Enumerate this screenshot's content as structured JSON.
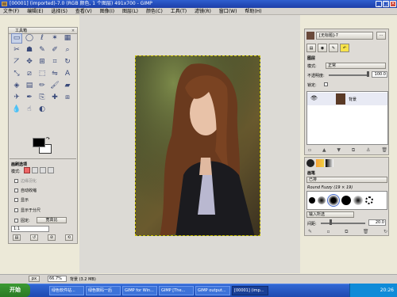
{
  "window": {
    "title": "[00001] (imported)-7.0 (RGB 颜色, 1 个图层) 491x700 - GIMP",
    "min": "_",
    "max": "□",
    "close": "×"
  },
  "menu": [
    "文件(F)",
    "编辑(E)",
    "选择(S)",
    "查看(V)",
    "图像(I)",
    "图层(L)",
    "颜色(C)",
    "工具(T)",
    "滤镜(R)",
    "窗口(W)",
    "帮助(H)"
  ],
  "toolbox": {
    "title": "工具箱",
    "tools": [
      {
        "name": "rect-select-icon",
        "glyph": "▭"
      },
      {
        "name": "ellipse-select-icon",
        "glyph": "◯"
      },
      {
        "name": "free-select-icon",
        "glyph": "ℓ"
      },
      {
        "name": "fuzzy-select-icon",
        "glyph": "✶"
      },
      {
        "name": "color-select-icon",
        "glyph": "▦"
      },
      {
        "name": "scissors-icon",
        "glyph": "✂"
      },
      {
        "name": "foreground-select-icon",
        "glyph": "☗"
      },
      {
        "name": "paths-icon",
        "glyph": "✎"
      },
      {
        "name": "color-picker-icon",
        "glyph": "✐"
      },
      {
        "name": "zoom-icon",
        "glyph": "⌕"
      },
      {
        "name": "measure-icon",
        "glyph": "⦢"
      },
      {
        "name": "move-icon",
        "glyph": "✥"
      },
      {
        "name": "align-icon",
        "glyph": "⊞"
      },
      {
        "name": "crop-icon",
        "glyph": "⌗"
      },
      {
        "name": "rotate-icon",
        "glyph": "↻"
      },
      {
        "name": "scale-icon",
        "glyph": "⤡"
      },
      {
        "name": "shear-icon",
        "glyph": "⧄"
      },
      {
        "name": "perspective-icon",
        "glyph": "⬚"
      },
      {
        "name": "flip-icon",
        "glyph": "⇋"
      },
      {
        "name": "text-icon",
        "glyph": "A"
      },
      {
        "name": "bucket-fill-icon",
        "glyph": "◈"
      },
      {
        "name": "blend-icon",
        "glyph": "▤"
      },
      {
        "name": "pencil-icon",
        "glyph": "✏"
      },
      {
        "name": "paintbrush-icon",
        "glyph": "🖌"
      },
      {
        "name": "eraser-icon",
        "glyph": "▰"
      },
      {
        "name": "airbrush-icon",
        "glyph": "✈"
      },
      {
        "name": "ink-icon",
        "glyph": "✒"
      },
      {
        "name": "clone-icon",
        "glyph": "⎘"
      },
      {
        "name": "heal-icon",
        "glyph": "✚"
      },
      {
        "name": "perspective-clone-icon",
        "glyph": "⧈"
      },
      {
        "name": "blur-icon",
        "glyph": "💧"
      },
      {
        "name": "smudge-icon",
        "glyph": "☝"
      },
      {
        "name": "dodge-burn-icon",
        "glyph": "◐"
      }
    ],
    "fg_color": "#000000",
    "bg_color": "#ffffff"
  },
  "tool_options": {
    "title": "画刷选项",
    "mode_label": "模式:",
    "options": [
      "边缘羽化",
      "自动收缩",
      "显示",
      "显示于分尺",
      "固定:"
    ],
    "fixed_value": "宽高比",
    "ratio_value": "1:1"
  },
  "layers": {
    "image_name": "[无标题]-7",
    "tab_label": "图层",
    "mode_label": "模式:",
    "mode_value": "正常",
    "opacity_label": "不透明度:",
    "opacity_value": "100.0",
    "lock_label": "锁定:",
    "layer_name": "背景"
  },
  "brushes": {
    "tab_label": "画笔",
    "view": "已排",
    "brush_name": "Round Fuzzy (19 × 19)",
    "spacing_label": "间距:",
    "spacing_value": "20.0",
    "select_value": "输入所选"
  },
  "statusbar": {
    "unit": "px",
    "zoom": "66.7%",
    "info": "背景 (3.2 MB)"
  },
  "taskbar": {
    "start": "开始",
    "tasks": [
      "绿色软件站...",
      "绿色数码一后",
      "GIMP for Win...",
      "GIMP [The...",
      "GIMP output...",
      "[00001] (imp..."
    ],
    "clock": "20:26"
  },
  "colors": {
    "title_blue": "#1f45b0",
    "canvas": "#dcdad5",
    "panel": "#dedbd6"
  }
}
